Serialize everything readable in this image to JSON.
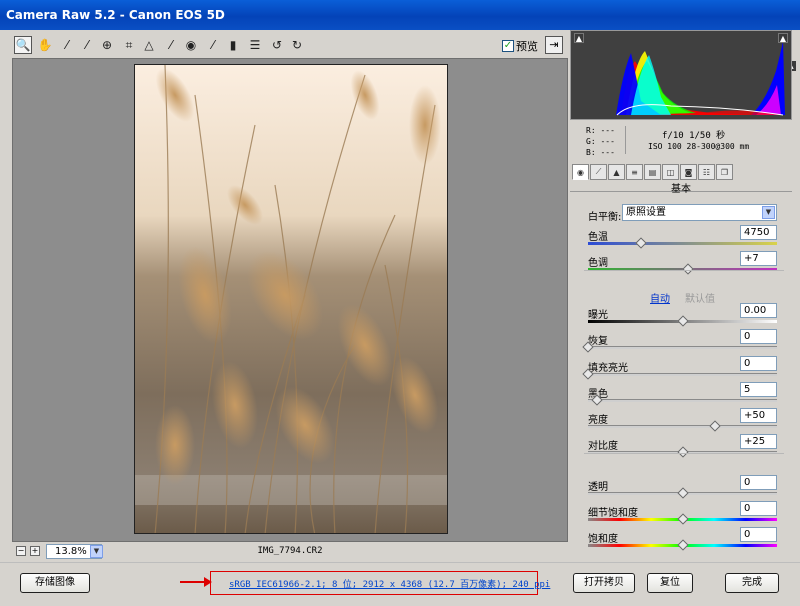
{
  "window": {
    "title": "Camera Raw 5.2 -  Canon EOS 5D"
  },
  "toolbar": {
    "tools": [
      "zoom-tool-icon",
      "hand-tool-icon",
      "white-balance-tool-icon",
      "color-sampler-tool-icon",
      "target-adjustment-tool-icon",
      "crop-tool-icon",
      "straighten-tool-icon",
      "spot-removal-tool-icon",
      "red-eye-removal-tool-icon",
      "adjustment-brush-icon",
      "graduated-filter-icon",
      "preferences-icon",
      "rotate-left-icon",
      "rotate-right-icon"
    ],
    "preview_label": "预览",
    "preview_checked": "✓"
  },
  "status": {
    "zoom": "13.8%",
    "filename": "IMG_7794.CR2",
    "minus": "−",
    "plus": "+"
  },
  "histogram": {
    "clip_left": "▲",
    "clip_right": "▲"
  },
  "info": {
    "rgb_lines": [
      "R:  ---",
      "G:  ---",
      "B:  ---"
    ],
    "camera_line1": "f/10   1/50 秒",
    "camera_line2": "ISO 100   28-300@300 mm"
  },
  "panel": {
    "title": "基本",
    "white_balance": {
      "label": "白平衡:",
      "value": "原照设置"
    },
    "auto_link": "自动",
    "default_link": "默认值",
    "adjustments": [
      {
        "label": "色温",
        "value": "4750",
        "pos": 0.28,
        "kind": "temp"
      },
      {
        "label": "色调",
        "value": "+7",
        "pos": 0.53,
        "kind": "tint"
      },
      {
        "label": "曝光",
        "value": "0.00",
        "pos": 0.5,
        "kind": "expo"
      },
      {
        "label": "恢复",
        "value": "0",
        "pos": 0.0,
        "kind": "plain"
      },
      {
        "label": "填充亮光",
        "value": "0",
        "pos": 0.0,
        "kind": "plain"
      },
      {
        "label": "黑色",
        "value": "5",
        "pos": 0.05,
        "kind": "plain"
      },
      {
        "label": "亮度",
        "value": "+50",
        "pos": 0.67,
        "kind": "plain"
      },
      {
        "label": "对比度",
        "value": "+25",
        "pos": 0.5,
        "kind": "plain"
      },
      {
        "label": "透明",
        "value": "0",
        "pos": 0.5,
        "kind": "plain"
      },
      {
        "label": "细节饱和度",
        "value": "0",
        "pos": 0.5,
        "kind": "vib"
      },
      {
        "label": "饱和度",
        "value": "0",
        "pos": 0.5,
        "kind": "vib"
      }
    ]
  },
  "footer": {
    "save_label": "存储图像",
    "workflow_info": "sRGB IEC61966-2.1; 8 位; 2912 x 4368 (12.7 百万像素); 240 ppi",
    "open_copy_label": "打开拷贝",
    "reset_label": "复位",
    "done_label": "完成"
  },
  "colors": {
    "title_bar": "#0a5fd8",
    "highlight_box": "#dd0000",
    "link": "#0033cc"
  }
}
